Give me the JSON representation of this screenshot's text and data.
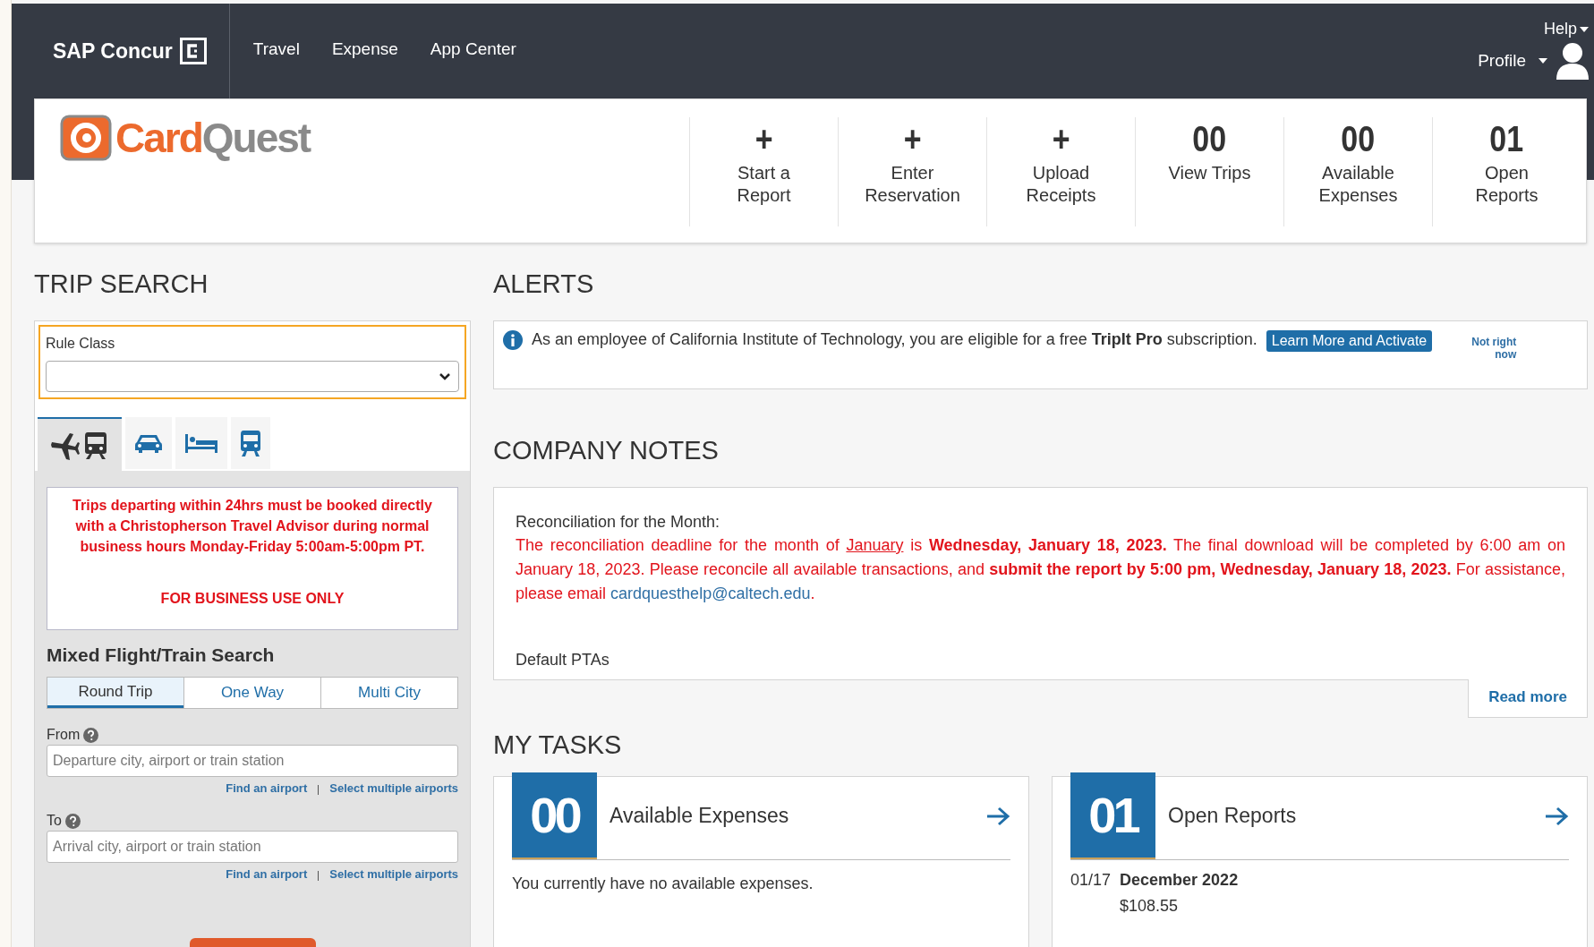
{
  "top_nav": {
    "brand": "SAP Concur",
    "items": [
      {
        "label": "Travel"
      },
      {
        "label": "Expense"
      },
      {
        "label": "App Center"
      }
    ],
    "help": "Help",
    "profile": "Profile"
  },
  "company_logo": {
    "primary": "Card",
    "secondary": "Quest"
  },
  "quick_actions": [
    {
      "value": "+",
      "label_lines": [
        "Start a",
        "Report"
      ]
    },
    {
      "value": "+",
      "label_lines": [
        "Enter",
        "Reservation"
      ]
    },
    {
      "value": "+",
      "label_lines": [
        "Upload",
        "Receipts"
      ]
    },
    {
      "value": "00",
      "label_lines": [
        "View Trips"
      ]
    },
    {
      "value": "00",
      "label_lines": [
        "Available",
        "Expenses"
      ]
    },
    {
      "value": "01",
      "label_lines": [
        "Open",
        "Reports"
      ]
    }
  ],
  "trip_search": {
    "heading": "TRIP SEARCH",
    "rule_class": {
      "label": "Rule Class",
      "highlighted": true
    },
    "mode_tabs": [
      {
        "kind": "flight_train",
        "selected": true
      },
      {
        "kind": "car",
        "selected": false
      },
      {
        "kind": "hotel",
        "selected": false
      },
      {
        "kind": "rail",
        "selected": false
      }
    ],
    "notice": [
      "Trips departing within 24hrs must be booked directly with a Christopherson Travel Advisor during normal business hours Monday-Friday 5:00am-5:00pm PT.",
      "FOR BUSINESS USE ONLY"
    ],
    "section_title": "Mixed Flight/Train Search",
    "trip_types": [
      {
        "label": "Round Trip",
        "selected": true
      },
      {
        "label": "One Way",
        "selected": false
      },
      {
        "label": "Multi City",
        "selected": false
      }
    ],
    "fields": [
      {
        "label": "From",
        "placeholder": "Departure city, airport or train station",
        "links": [
          "Find an airport",
          "Select multiple airports"
        ]
      },
      {
        "label": "To",
        "placeholder": "Arrival city, airport or train station",
        "links": [
          "Find an airport",
          "Select multiple airports"
        ]
      }
    ]
  },
  "alerts": {
    "heading": "ALERTS",
    "message": "As an employee of California Institute of Technology, you are eligible for a free **TripIt Pro** subscription.",
    "action": "Learn More and Activate",
    "dismiss": "Not right now"
  },
  "company_notes": {
    "heading": "COMPANY NOTES",
    "title": "Reconciliation for the Month:",
    "body": [
      {
        "kind": "plain",
        "text": "The reconciliation deadline for the month of "
      },
      {
        "kind": "link",
        "text": "January"
      },
      {
        "kind": "plain",
        "text": " is "
      },
      {
        "kind": "bold",
        "text": "Wednesday, January 18, 2023."
      },
      {
        "kind": "plain",
        "text": " The final download will be completed by 6:00 am on January 18, 2023. Please reconcile all available transactions, and "
      },
      {
        "kind": "bold",
        "text": "submit the report by 5:00 pm, Wednesday, January 18, 2023."
      },
      {
        "kind": "plain",
        "text": "  For assistance, please email "
      },
      {
        "kind": "email",
        "text": "cardquesthelp@caltech.edu"
      },
      {
        "kind": "plain",
        "text": "."
      }
    ],
    "subtitle": "Default PTAs",
    "read_more": "Read more"
  },
  "my_tasks": {
    "heading": "MY TASKS",
    "cards": [
      {
        "count": "00",
        "title": "Available Expenses",
        "empty_text": "You currently have no available expenses."
      },
      {
        "count": "01",
        "title": "Open Reports",
        "items": [
          {
            "date": "01/17",
            "name": "December 2022",
            "amount": "$108.55"
          }
        ]
      }
    ]
  }
}
